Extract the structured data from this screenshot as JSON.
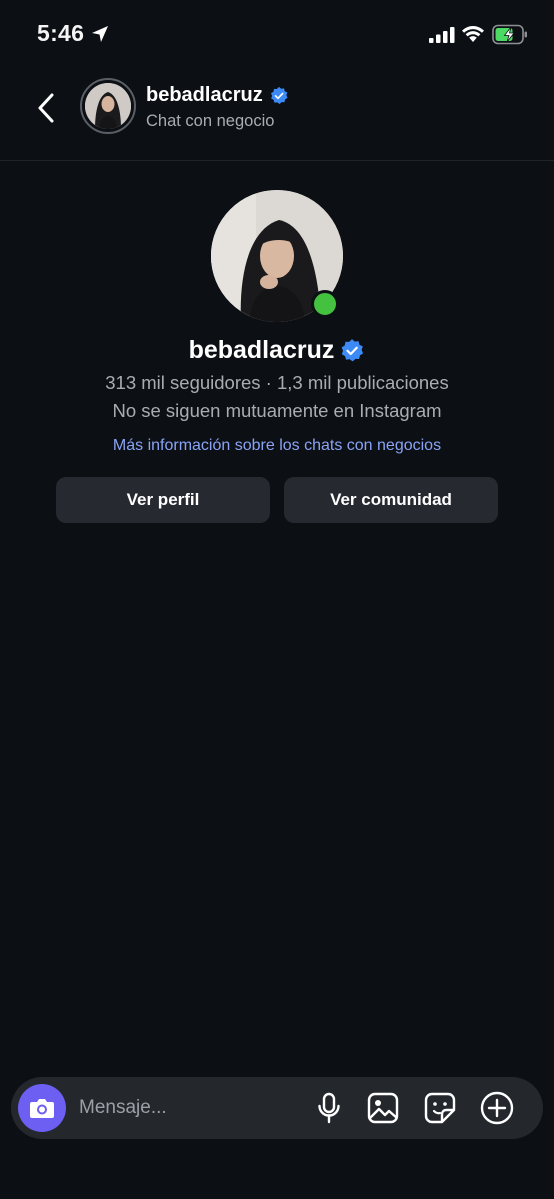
{
  "status_bar": {
    "time": "5:46"
  },
  "header": {
    "username": "bebadlacruz",
    "subtitle": "Chat con negocio"
  },
  "profile": {
    "username": "bebadlacruz",
    "stats": "313 mil seguidores · 1,3 mil publicaciones",
    "mutual": "No se siguen mutuamente en Instagram",
    "info_link": "Más información sobre los chats con negocios",
    "online": true
  },
  "actions": {
    "view_profile": "Ver perfil",
    "view_community": "Ver comunidad"
  },
  "composer": {
    "placeholder": "Mensaje..."
  },
  "colors": {
    "background": "#0c1014",
    "accent_camera": "#6c5ff2",
    "verified": "#3d8af7",
    "online": "#44c13e",
    "link": "#8aa3f5",
    "battery_charge": "#4cd964"
  }
}
